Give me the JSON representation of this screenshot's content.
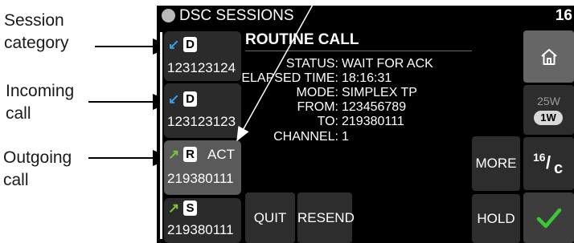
{
  "callouts": {
    "session_category": [
      "Session",
      "category"
    ],
    "incoming_call": [
      "Incoming",
      "call"
    ],
    "outgoing_call": [
      "Outgoing",
      "call"
    ]
  },
  "header": {
    "title": "DSC SESSIONS",
    "number": "16"
  },
  "sessions": [
    {
      "badge": "D",
      "number": "123123124",
      "arrow": "↙",
      "arrow_color": "#35a0ea",
      "status": ""
    },
    {
      "badge": "D",
      "number": "123123123",
      "arrow": "↙",
      "arrow_color": "#35a0ea",
      "status": ""
    },
    {
      "badge": "R",
      "number": "219380111",
      "arrow": "↗",
      "arrow_color": "#7cc43e",
      "status": "ACT"
    },
    {
      "badge": "S",
      "number": "219380111",
      "arrow": "↗",
      "arrow_color": "#7cc43e",
      "status": ""
    }
  ],
  "call": {
    "title": "ROUTINE CALL",
    "fields": [
      {
        "label": "STATUS:",
        "value": "WAIT FOR ACK"
      },
      {
        "label": "ELAPSED TIME:",
        "value": "18:16:31"
      },
      {
        "label": "MODE:",
        "value": "SIMPLEX TP"
      },
      {
        "label": "FROM:",
        "value": "123456789"
      },
      {
        "label": "TO:",
        "value": "219380111"
      },
      {
        "label": "CHANNEL:",
        "value": "1"
      }
    ]
  },
  "buttons": {
    "quit": "QUIT",
    "resend": "RESEND",
    "more": "MORE",
    "hold": "HOLD",
    "power_high": "25W",
    "power_low": "1W",
    "channel_num": "16",
    "channel_suffix": "c"
  },
  "icons": {
    "home": "home-icon",
    "confirm": "checkmark-icon",
    "check_color": "#3cc63a"
  }
}
